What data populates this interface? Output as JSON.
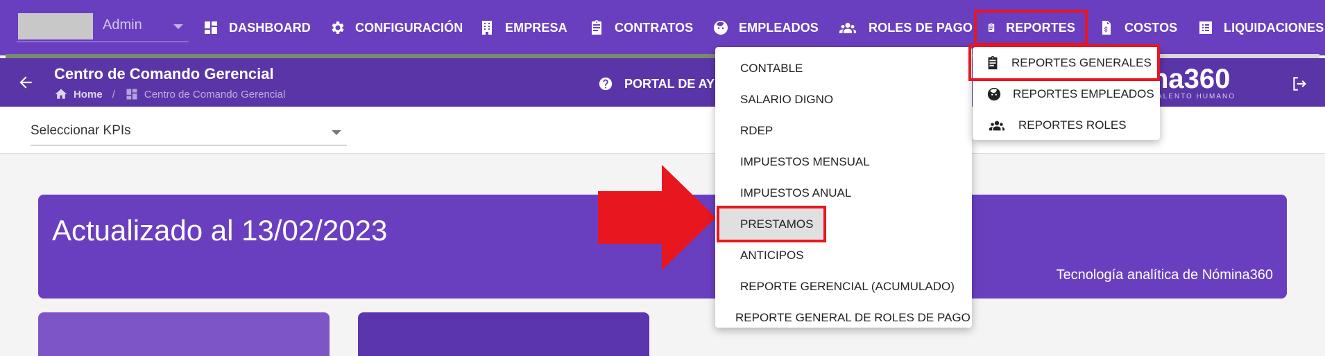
{
  "topnav": {
    "user": {
      "name": "Admin"
    },
    "items": [
      {
        "label": "DASHBOARD",
        "icon": "dashboard-icon"
      },
      {
        "label": "CONFIGURACIÓN",
        "icon": "gear-icon"
      },
      {
        "label": "EMPRESA",
        "icon": "building-icon"
      },
      {
        "label": "CONTRATOS",
        "icon": "clipboard-icon"
      },
      {
        "label": "EMPLEADOS",
        "icon": "face-icon"
      },
      {
        "label": "ROLES DE PAGO",
        "icon": "group-icon"
      },
      {
        "label": "REPORTES",
        "icon": "clipboard-icon",
        "active": true
      },
      {
        "label": "COSTOS",
        "icon": "invoice-icon"
      },
      {
        "label": "LIQUIDACIONES",
        "icon": "list-icon"
      }
    ],
    "progress": 0.82
  },
  "header": {
    "title": "Centro de Comando Gerencial",
    "breadcrumb_home": "Home",
    "breadcrumb_current": "Centro de Comando Gerencial",
    "help": "PORTAL DE AYUDA",
    "logo": "na360",
    "logo_sub": "ALENTO HUMANO"
  },
  "kpi": {
    "label": "Seleccionar KPIs"
  },
  "banner": {
    "title": "Actualizado al 13/02/2023",
    "subtitle": "Tecnología analítica de Nómina360"
  },
  "reportes_menu": {
    "items": [
      "CONTABLE",
      "SALARIO DIGNO",
      "RDEP",
      "IMPUESTOS MENSUAL",
      "IMPUESTOS ANUAL",
      "PRESTAMOS",
      "ANTICIPOS",
      "REPORTE GERENCIAL (ACUMULADO)",
      "REPORTE GENERAL DE ROLES DE PAGO"
    ],
    "highlighted": "PRESTAMOS"
  },
  "reportes_submenu": {
    "items": [
      {
        "label": "REPORTES GENERALES",
        "icon": "clipboard-icon"
      },
      {
        "label": "REPORTES EMPLEADOS",
        "icon": "face-icon"
      },
      {
        "label": "REPORTES ROLES",
        "icon": "group-icon"
      }
    ]
  },
  "colors": {
    "primary": "#6a3fbf",
    "header": "#5a35a8",
    "highlight": "#e8161e"
  }
}
